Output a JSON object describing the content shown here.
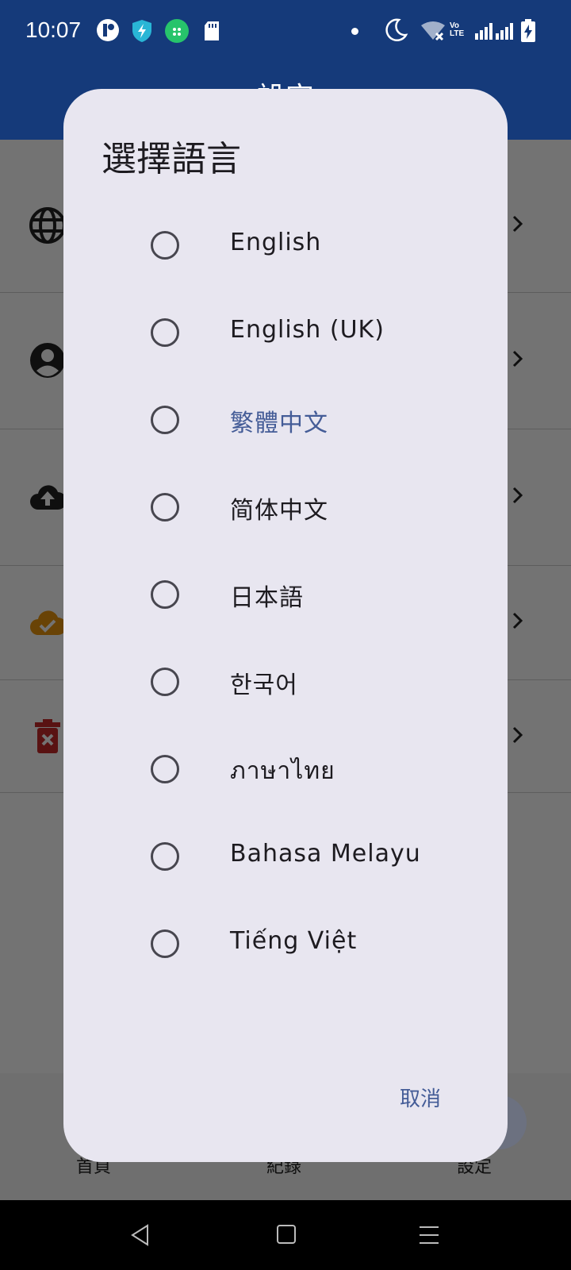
{
  "status_bar": {
    "time": "10:07",
    "left_icons": [
      "app-k-icon",
      "shield-bolt-icon",
      "android-icon",
      "sd-card-icon"
    ],
    "right_icons": [
      "dot-icon",
      "moon-icon",
      "wifi-off-icon",
      "volte-icon",
      "signal-icon",
      "signal-icon",
      "battery-charging-icon"
    ]
  },
  "app_bar": {
    "title": "設定"
  },
  "settings_rows": [
    {
      "icon": "globe-icon"
    },
    {
      "icon": "account-circle-icon"
    },
    {
      "icon": "cloud-upload-icon"
    },
    {
      "icon": "cloud-check-icon"
    },
    {
      "icon": "delete-icon"
    }
  ],
  "bottom_nav": {
    "items": [
      {
        "label": "首頁"
      },
      {
        "label": "紀錄"
      },
      {
        "label": "設定"
      }
    ]
  },
  "dialog": {
    "title": "選擇語言",
    "options": [
      {
        "label": "English",
        "selected": false
      },
      {
        "label": "English (UK)",
        "selected": false
      },
      {
        "label": "繁體中文",
        "selected": false,
        "highlighted": true
      },
      {
        "label": "简体中文",
        "selected": false
      },
      {
        "label": "日本語",
        "selected": false
      },
      {
        "label": "한국어",
        "selected": false
      },
      {
        "label": "ภาษาไทย",
        "selected": false
      },
      {
        "label": "Bahasa Melayu",
        "selected": false
      },
      {
        "label": "Tiếng Việt",
        "selected": false
      }
    ],
    "cancel_label": "取消"
  },
  "colors": {
    "primary": "#153a7a",
    "dialog_bg": "#e8e6f0",
    "accent_text": "#445c97",
    "scrim": "rgba(0,0,0,0.55)"
  }
}
